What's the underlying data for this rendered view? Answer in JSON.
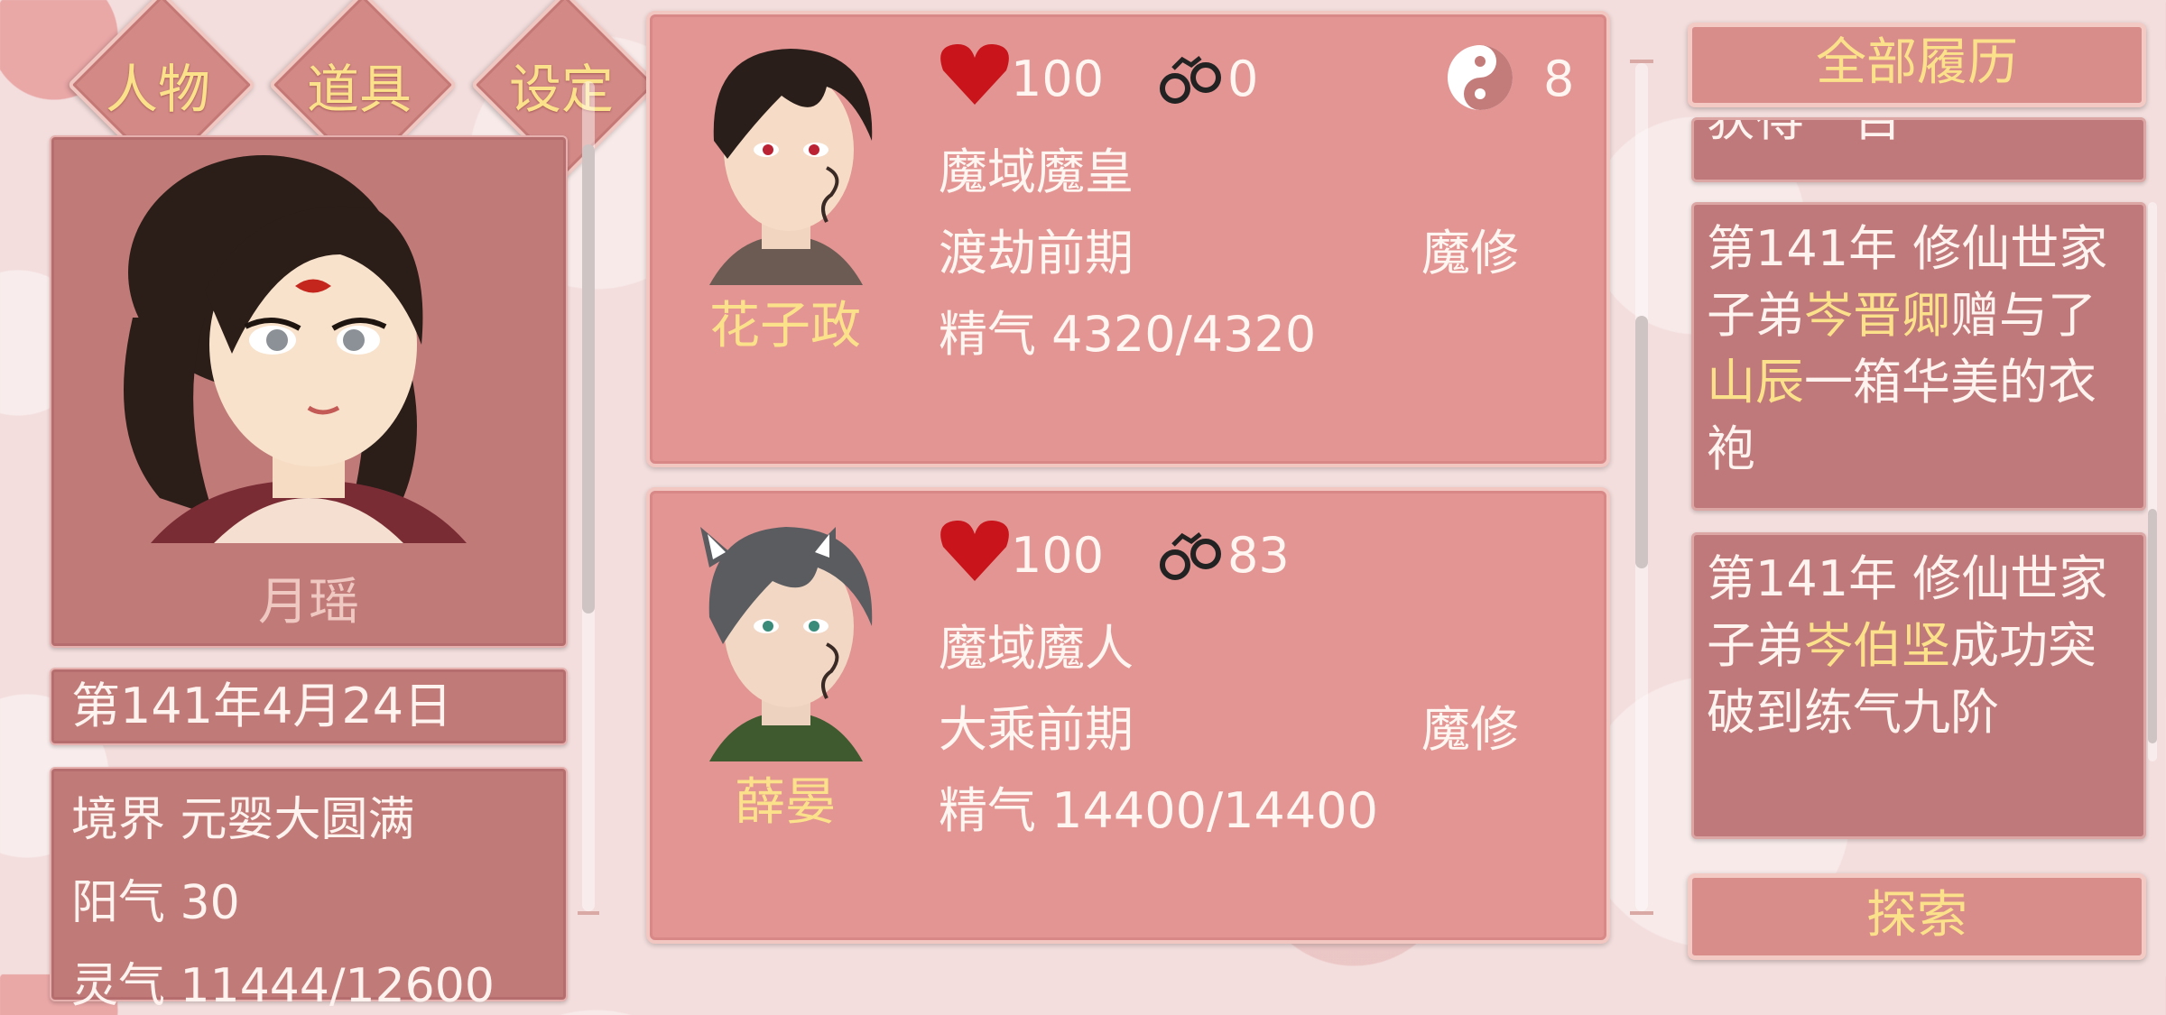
{
  "tabs": [
    {
      "label": "人物"
    },
    {
      "label": "道具"
    },
    {
      "label": "设定"
    }
  ],
  "player": {
    "name": "月瑶",
    "date": "第141年4月24日",
    "stats": [
      {
        "label": "境界",
        "value": "元婴大圆满"
      },
      {
        "label": "阳气",
        "value": "30"
      },
      {
        "label": "灵气",
        "value": "11444/12600"
      }
    ]
  },
  "characters": [
    {
      "name": "花子政",
      "hp": "100",
      "bind": "0",
      "yinyang": "8",
      "title": "魔域魔皇",
      "realm": "渡劫前期",
      "school": "魔修",
      "essence": "精气 4320/4320",
      "hair": "#2a1e1a"
    },
    {
      "name": "薛晏",
      "hp": "100",
      "bind": "83",
      "title": "魔域魔人",
      "realm": "大乘前期",
      "school": "魔修",
      "essence": "精气 14400/14400",
      "hair": "#5a5c60"
    }
  ],
  "history": {
    "top_button": "全部履历",
    "bottom_button": "探索",
    "clipped_entry": "获得一百",
    "entries": [
      {
        "prefix": "第141年 修仙世家子弟",
        "name1": "岑晋卿",
        "mid": "赠与了",
        "name2": "山辰",
        "suffix": "一箱华美的衣袍"
      },
      {
        "prefix": "第141年 修仙世家子弟",
        "name1": "岑伯坚",
        "mid": "成功突破到练气九阶"
      }
    ]
  },
  "colors": {
    "accent_gold": "#fbe28a",
    "panel": "#c07a78",
    "card": "#e29593",
    "heart": "#c8141a"
  }
}
